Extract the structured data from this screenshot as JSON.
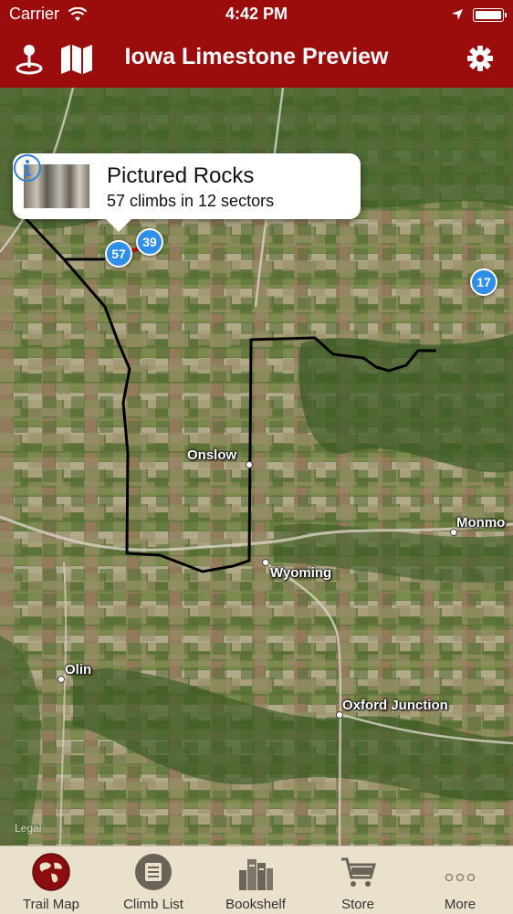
{
  "status_bar": {
    "carrier": "Carrier",
    "time": "4:42 PM"
  },
  "nav": {
    "title": "Iowa Limestone Preview",
    "left_icons": [
      "location-pin-icon",
      "map-icon"
    ],
    "right_icon": "gear-icon"
  },
  "map": {
    "callout": {
      "title": "Pictured Rocks",
      "subtitle": "57 climbs in 12 sectors"
    },
    "clusters": [
      "57",
      "39",
      "17"
    ],
    "towns": [
      "Onslow",
      "Wyoming",
      "Monmo",
      "Olin",
      "Oxford Junction"
    ],
    "legal": "Legal"
  },
  "tabs": [
    {
      "label": "Trail Map",
      "icon": "globe-icon",
      "active": true
    },
    {
      "label": "Climb List",
      "icon": "list-icon",
      "active": false
    },
    {
      "label": "Bookshelf",
      "icon": "books-icon",
      "active": false
    },
    {
      "label": "Store",
      "icon": "cart-icon",
      "active": false
    },
    {
      "label": "More",
      "icon": "more-dots-icon",
      "active": false
    }
  ],
  "colors": {
    "brand": "#9b0c0c",
    "cluster": "#2f8ee8",
    "tab_bar": "#e9e1cc",
    "active_tab": "#8b0d0d"
  }
}
